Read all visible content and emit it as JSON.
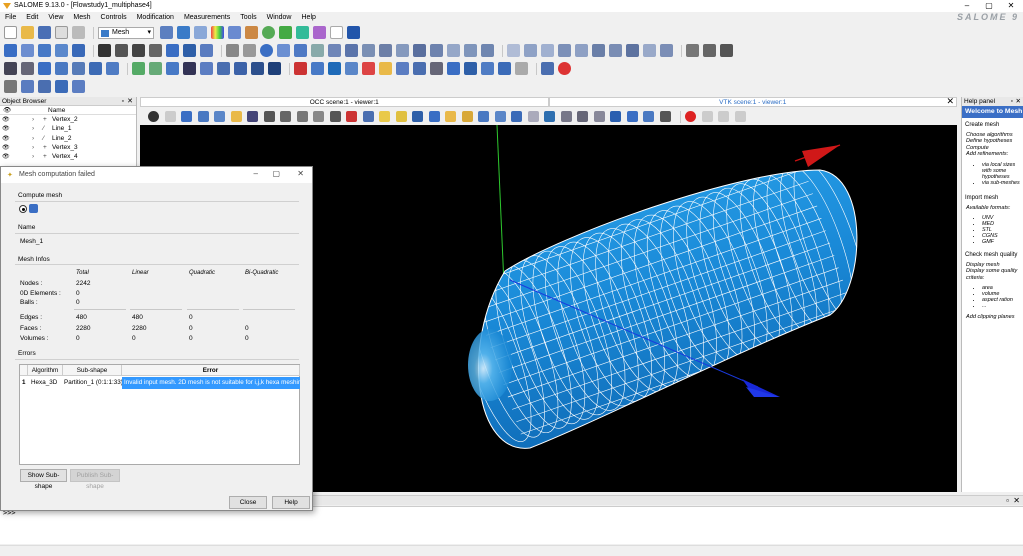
{
  "window": {
    "title": "SALOME 9.13.0 - [Flowstudy1_multiphase4]",
    "brand": "SALOME 9",
    "min": "–",
    "max": "▢",
    "close": "✕"
  },
  "menu": [
    "File",
    "Edit",
    "View",
    "Mesh",
    "Controls",
    "Modification",
    "Measurements",
    "Tools",
    "Window",
    "Help"
  ],
  "module_select": {
    "value": "Mesh",
    "caret": "▾"
  },
  "object_browser": {
    "title": "Object Browser",
    "header_buttons": [
      "▫",
      "✕"
    ],
    "column": "Name",
    "rows": [
      {
        "expander": "›",
        "glyph": "+",
        "label": "Vertex_2"
      },
      {
        "expander": "›",
        "glyph": "⁄",
        "label": "Line_1"
      },
      {
        "expander": "›",
        "glyph": "⁄",
        "label": "Line_2"
      },
      {
        "expander": "›",
        "glyph": "+",
        "label": "Vertex_3"
      },
      {
        "expander": "›",
        "glyph": "+",
        "label": "Vertex_4"
      }
    ]
  },
  "views": {
    "tabs": [
      "OCC scene:1 - viewer:1",
      "VTK scene:1 - viewer:1"
    ],
    "active_tab": 1,
    "close": "✕"
  },
  "help_panel": {
    "title": "Help panel",
    "header_buttons": [
      "▫",
      "✕"
    ],
    "welcome": "Welcome to Mesh",
    "sections": [
      {
        "heading": "Create mesh",
        "text": [
          "Choose algorithms",
          "Define hypotheses",
          "Compute",
          "Add refinements:"
        ],
        "bullets": [
          "via local sizes with some hypotheses",
          "via sub-meshes"
        ]
      },
      {
        "heading": "Import mesh",
        "text": [
          "Available formats:"
        ],
        "bullets": [
          "UNV",
          "MED",
          "STL",
          "CGNS",
          "GMF"
        ]
      },
      {
        "heading": "Check mesh quality",
        "text": [
          "Display mesh",
          "Display some quality criteria:"
        ],
        "bullets": [
          "area",
          "volume",
          "aspect ration",
          "..."
        ]
      }
    ],
    "footer": "Add clipping planes"
  },
  "console": {
    "prompt": ">>>",
    "header_buttons": [
      "▫",
      "✕"
    ]
  },
  "dialog": {
    "title": "Mesh computation failed",
    "icon": "✦",
    "min": "–",
    "max": "▢",
    "close": "✕",
    "compute_mesh_label": "Compute mesh",
    "name_label": "Name",
    "name_value": "Mesh_1",
    "mesh_infos_label": "Mesh Infos",
    "columns": [
      "Total",
      "Linear",
      "Quadratic",
      "Bi-Quadratic"
    ],
    "rows": [
      {
        "label": "Nodes :",
        "values": [
          "2242",
          "",
          "",
          ""
        ]
      },
      {
        "label": "0D Elements :",
        "values": [
          "0",
          "",
          "",
          ""
        ]
      },
      {
        "label": "Balls :",
        "values": [
          "0",
          "",
          "",
          ""
        ]
      },
      {
        "label": "Edges :",
        "values": [
          "480",
          "480",
          "0",
          ""
        ]
      },
      {
        "label": "Faces :",
        "values": [
          "2280",
          "2280",
          "0",
          "0"
        ]
      },
      {
        "label": "Volumes :",
        "values": [
          "0",
          "0",
          "0",
          "0"
        ]
      }
    ],
    "errors_label": "Errors",
    "error_headers": [
      "Algorithm",
      "Sub-shape",
      "Error"
    ],
    "errors": [
      {
        "index": "1",
        "algorithm": "Hexa_3D",
        "subshape": "Partition_1 (0:1:1:33)",
        "error": "Invalid input mesh. 2D mesh is not suitable for i,j,k hexa meshing"
      }
    ],
    "show_subshape": "Show Sub-shape",
    "publish_subshape": "Publish Sub-shape",
    "close_btn": "Close",
    "help_btn": "Help"
  },
  "colors": {
    "accent": "#3b6fc6",
    "mesh_fill": "#1e90d8",
    "selection": "#3399ff"
  }
}
